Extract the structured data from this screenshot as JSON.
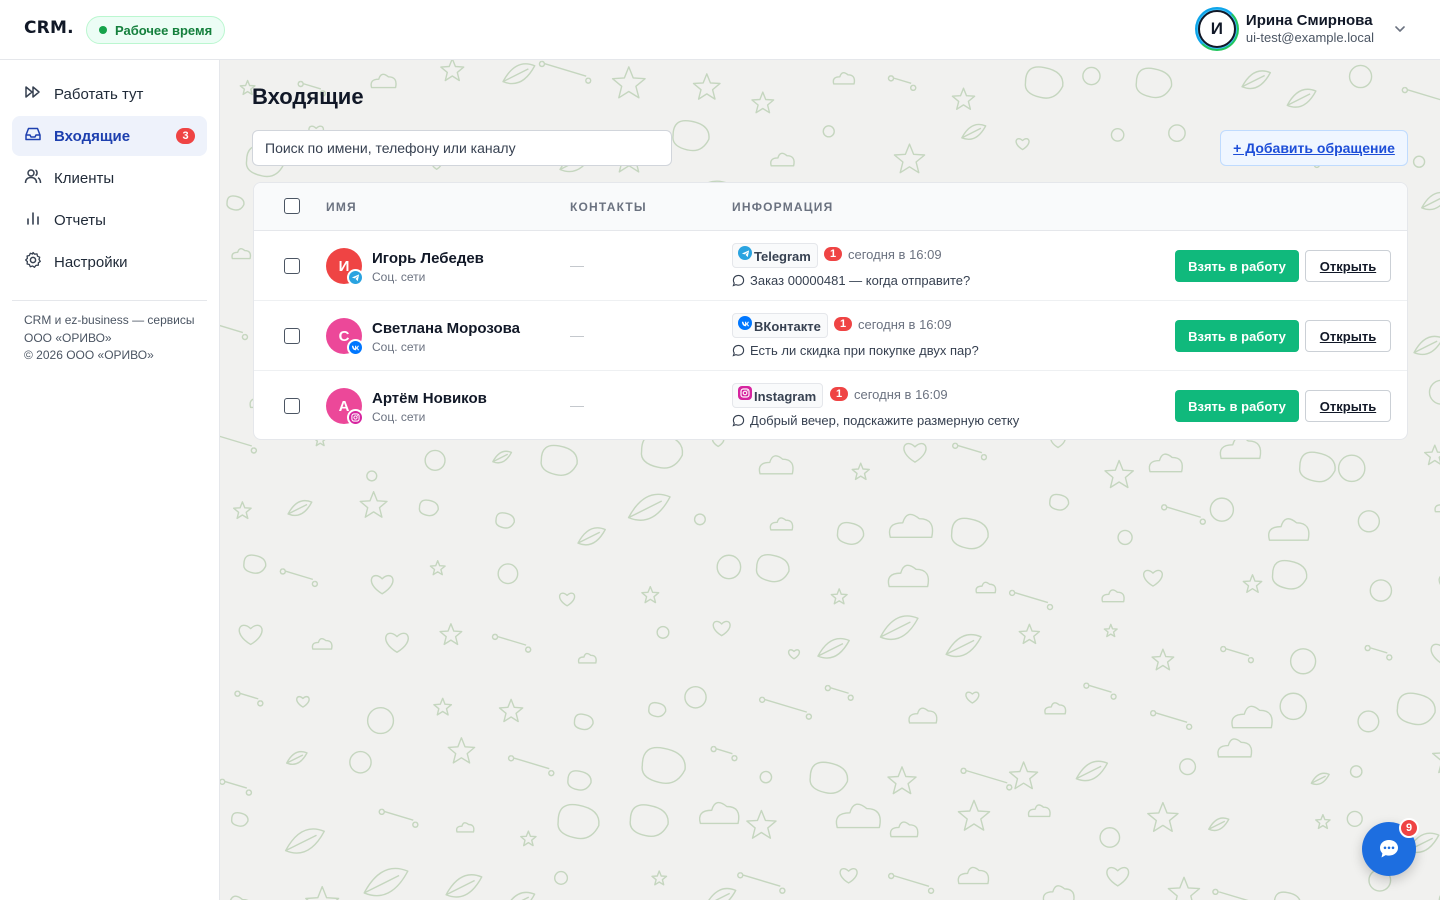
{
  "header": {
    "logo": "CRM.",
    "work_status": "Рабочее время",
    "user": {
      "initial": "И",
      "name": "Ирина Смирнова",
      "email": "ui-test@example.local"
    }
  },
  "sidebar": {
    "items": [
      {
        "label": "Работать тут",
        "icon": "fast-forward-icon"
      },
      {
        "label": "Входящие",
        "icon": "inbox-icon",
        "badge": "3",
        "active": true
      },
      {
        "label": "Клиенты",
        "icon": "users-icon"
      },
      {
        "label": "Отчеты",
        "icon": "bar-chart-icon"
      },
      {
        "label": "Настройки",
        "icon": "gear-icon"
      }
    ],
    "footer_line1": "CRM и ez-business — сервисы ООО «ОРИВО»",
    "footer_line2": "© 2026 ООО «ОРИВО»"
  },
  "main": {
    "title": "Входящие",
    "search_placeholder": "Поиск по имени, телефону или каналу",
    "add_button": "+ Добавить обращение",
    "columns": {
      "name": "ИМЯ",
      "contacts": "КОНТАКТЫ",
      "info": "ИНФОРМАЦИЯ"
    },
    "rows": [
      {
        "initial": "И",
        "avatar_color": "#ef4444",
        "name": "Игорь Лебедев",
        "source": "Соц. сети",
        "contacts": "—",
        "channel": "Telegram",
        "channel_color": "#2aa3e0",
        "unread": "1",
        "time": "сегодня в 16:09",
        "message": "Заказ 00000481 — когда отправите?",
        "take_label": "Взять в работу",
        "open_label": "Открыть"
      },
      {
        "initial": "С",
        "avatar_color": "#ec4899",
        "name": "Светлана Морозова",
        "source": "Соц. сети",
        "contacts": "—",
        "channel": "ВКонтакте",
        "channel_color": "#0077ff",
        "unread": "1",
        "time": "сегодня в 16:09",
        "message": "Есть ли скидка при покупке двух пар?",
        "take_label": "Взять в работу",
        "open_label": "Открыть"
      },
      {
        "initial": "А",
        "avatar_color": "#ec4899",
        "name": "Артём Новиков",
        "source": "Соц. сети",
        "contacts": "—",
        "channel": "Instagram",
        "channel_color": "#d6249f",
        "unread": "1",
        "time": "сегодня в 16:09",
        "message": "Добрый вечер, подскажите размерную сетку",
        "take_label": "Взять в работу",
        "open_label": "Открыть"
      }
    ]
  },
  "chat_widget": {
    "badge": "9",
    "icon": "chat-icon"
  },
  "colors": {
    "accent": "#10b97c",
    "active_nav": "#1e40af",
    "badge": "#ef4444",
    "fab": "#1d6ee0"
  }
}
